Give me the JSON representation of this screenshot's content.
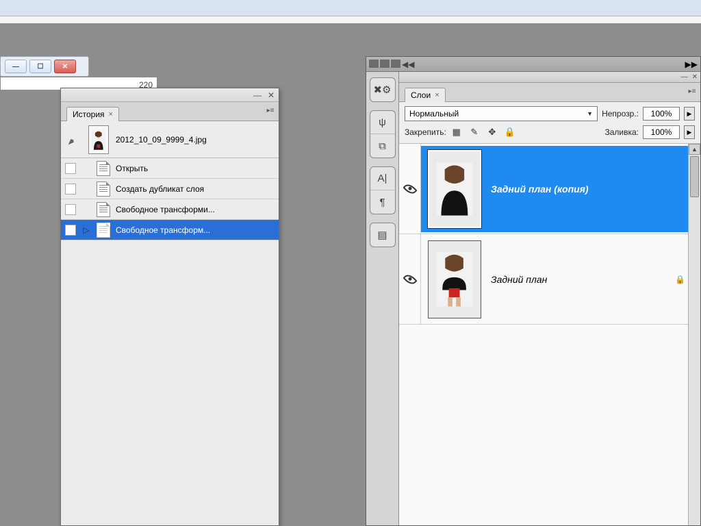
{
  "ruler": {
    "mark": "220"
  },
  "history": {
    "tab_label": "История",
    "document_name": "2012_10_09_9999_4.jpg",
    "items": [
      {
        "label": "Открыть",
        "current": false,
        "selected": false
      },
      {
        "label": "Создать дубликат слоя",
        "current": false,
        "selected": false
      },
      {
        "label": "Свободное трансформи...",
        "current": false,
        "selected": false
      },
      {
        "label": "Свободное трансформ...",
        "current": true,
        "selected": true
      }
    ]
  },
  "layers": {
    "tab_label": "Слои",
    "blend_mode_label": "Нормальный",
    "opacity_label": "Непрозр.:",
    "opacity_value": "100%",
    "lock_label": "Закрепить:",
    "fill_label": "Заливка:",
    "fill_value": "100%",
    "items": [
      {
        "name": "Задний план (копия)",
        "visible": true,
        "selected": true,
        "locked": false
      },
      {
        "name": "Задний план",
        "visible": true,
        "selected": false,
        "locked": true
      }
    ]
  }
}
